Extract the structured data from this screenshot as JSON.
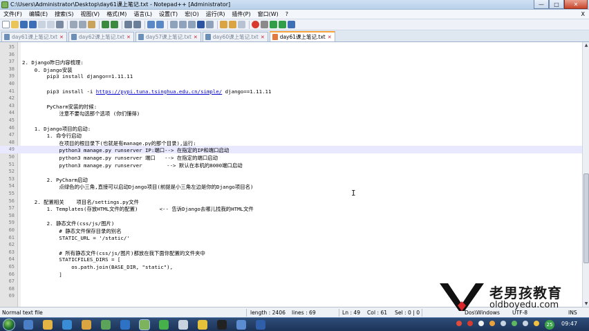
{
  "window": {
    "title": "C:\\Users\\Administrator\\Desktop\\day61课上笔记.txt - Notepad++ [Administrator]",
    "min": "—",
    "max": "□",
    "close": "✕"
  },
  "menu": {
    "items": [
      "文件(F)",
      "编辑(E)",
      "搜索(S)",
      "视图(V)",
      "格式(M)",
      "语言(L)",
      "设置(T)",
      "宏(O)",
      "运行(R)",
      "插件(P)",
      "窗口(W)",
      "?"
    ],
    "close": "X"
  },
  "tabs": [
    {
      "label": "day61课上笔记.txt",
      "active": false
    },
    {
      "label": "day62课上笔记.txt",
      "active": false
    },
    {
      "label": "day57课上笔记.txt",
      "active": false
    },
    {
      "label": "day60课上笔记.txt",
      "active": false
    },
    {
      "label": "day61课上笔记.txt",
      "active": true
    }
  ],
  "editor": {
    "current_line": 49,
    "lines": [
      {
        "n": "35",
        "t": ""
      },
      {
        "n": "36",
        "t": ""
      },
      {
        "n": "37",
        "t": "2. Django昨日内容梳理:"
      },
      {
        "n": "38",
        "t": "    0. Django安装"
      },
      {
        "n": "39",
        "t": "        pip3 install django==1.11.11"
      },
      {
        "n": "40",
        "t": ""
      },
      {
        "n": "41",
        "t": "        pip3 install -i ",
        "u": "https://pypi.tuna.tsinghua.edu.cn/simple/",
        "t2": " django==1.11.11"
      },
      {
        "n": "42",
        "t": ""
      },
      {
        "n": "43",
        "t": "        PyCharm安装的时候:"
      },
      {
        "n": "44",
        "t": "            注意不要勾选那个选项 (你们懂得)"
      },
      {
        "n": "45",
        "t": ""
      },
      {
        "n": "46",
        "t": "    1. Django项目的启动:"
      },
      {
        "n": "47",
        "t": "        1. 命令行启动"
      },
      {
        "n": "48",
        "t": "            在项目的根目录下(也就是有manage.py的那个目录),运行:"
      },
      {
        "n": "49",
        "t": "            python3 manage.py runserver IP:端口--> 在指定的IP和端口启动"
      },
      {
        "n": "50",
        "t": "            python3 manage.py runserver 端口   --> 在指定的端口启动"
      },
      {
        "n": "51",
        "t": "            python3 manage.py runserver        --> 默认在本机的8000端口启动"
      },
      {
        "n": "52",
        "t": ""
      },
      {
        "n": "53",
        "t": "        2. PyCharm启动"
      },
      {
        "n": "54",
        "t": "            点绿色的小三角,直接可以启动Django项目(前提是小三角左边是你的Django项目名)"
      },
      {
        "n": "55",
        "t": ""
      },
      {
        "n": "56",
        "t": "    2. 配置相关    项目名/settings.py文件"
      },
      {
        "n": "57",
        "t": "        1. Templates(存放HTML文件的配置)       <-- 告诉Django去哪儿找我的HTML文件"
      },
      {
        "n": "58",
        "t": ""
      },
      {
        "n": "59",
        "t": "        2. 静态文件(css/js/图片)"
      },
      {
        "n": "60",
        "t": "            # 静态文件保存目录的别名"
      },
      {
        "n": "61",
        "t": "            STATIC_URL = '/static/'"
      },
      {
        "n": "62",
        "t": ""
      },
      {
        "n": "63",
        "t": "            # 所有静态文件(css/js/图片)都放在我下面你配置的文件夹中"
      },
      {
        "n": "64",
        "t": "            STATICFILES_DIRS = ["
      },
      {
        "n": "65",
        "t": "                os.path.join(BASE_DIR, \"static\"),"
      },
      {
        "n": "66",
        "t": "            ]"
      },
      {
        "n": "67",
        "t": ""
      },
      {
        "n": "68",
        "t": ""
      },
      {
        "n": "69",
        "t": ""
      }
    ]
  },
  "status": {
    "type": "Normal text file",
    "length": "length : 2406",
    "lines": "lines : 69",
    "ln": "Ln : 49",
    "col": "Col : 61",
    "sel": "Sel : 0 | 0",
    "eol": "Dos\\Windows",
    "enc": "UTF-8",
    "ins": "INS"
  },
  "taskbar": {
    "badge": "25",
    "clock": "09:47"
  },
  "watermark": {
    "text": "老男孩教育",
    "url": "oldboyedu.com"
  },
  "colors": {
    "accent_tab": "#f7a23b",
    "current_line": "#e8e8ff",
    "link": "#0000cc"
  }
}
